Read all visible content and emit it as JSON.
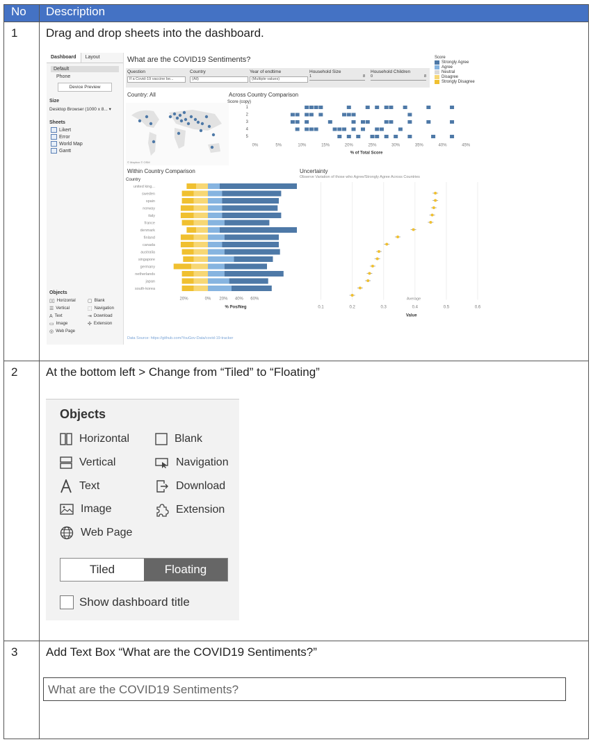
{
  "table": {
    "headers": {
      "no": "No",
      "description": "Description"
    },
    "rows": [
      {
        "no": "1",
        "text": "Drag and drop sheets into the dashboard."
      },
      {
        "no": "2",
        "text": "At the bottom left > Change from “Tiled” to “Floating”"
      },
      {
        "no": "3",
        "text": "Add Text Box “What are the COVID19 Sentiments?”"
      }
    ]
  },
  "dashboard": {
    "tabs": [
      "Dashboard",
      "Layout"
    ],
    "device_items": [
      "Default",
      "Phone"
    ],
    "device_preview_button": "Device Preview",
    "size_heading": "Size",
    "size_value": "Desktop Browser (1000 x 8... ▾",
    "sheets_heading": "Sheets",
    "sheets": [
      "Likert",
      "Error",
      "World Map",
      "Gantt"
    ],
    "objects_heading": "Objects",
    "objects_small": [
      "Horizontal",
      "Blank",
      "Vertical",
      "Navigation",
      "Text",
      "Download",
      "Image",
      "Extension",
      "Web Page"
    ],
    "title": "What are the COVID19 Sentiments?",
    "filters": {
      "question_label": "Question",
      "question_value": "If a Covid-19 vaccine be...",
      "country_label": "Country",
      "country_value": "(All)",
      "year_label": "Year of endtime",
      "year_value": "(Multiple values)",
      "household_size_label": "Household Size",
      "household_size_min": "1",
      "household_size_max": "8",
      "household_children_label": "Household Children",
      "household_children_min": "0",
      "household_children_max": "8"
    },
    "legend": {
      "title": "Score",
      "items": [
        {
          "label": "Strongly Agree",
          "color": "#4e79a7"
        },
        {
          "label": "Agree",
          "color": "#86b4e0"
        },
        {
          "label": "Neutral",
          "color": "#d9d9d9"
        },
        {
          "label": "Disagree",
          "color": "#f7d774"
        },
        {
          "label": "Strongly Disagree",
          "color": "#f0c030"
        }
      ]
    },
    "map_title": "Country: All",
    "map_credit": "© Mapbox © OSM",
    "across_title": "Across Country Comparison",
    "within_title": "Within Country Comparison",
    "uncertainty_title": "Uncertainty",
    "uncertainty_subtitle": "Observe Variation of those who Agree/Strongly Agree Across Countries",
    "data_source": "Data Source: https://github.com/YouGov-Data/covid-19-tracker"
  },
  "chart_data": [
    {
      "type": "scatter",
      "title": "Across Country Comparison",
      "ylabel": "Score (copy)",
      "xlabel": "% of Total Score",
      "categories": [
        "1",
        "2",
        "3",
        "4",
        "5"
      ],
      "x_ticks": [
        "0%",
        "5%",
        "10%",
        "15%",
        "20%",
        "25%",
        "30%",
        "35%",
        "40%",
        "45%"
      ],
      "series": [
        {
          "values": [
            [
              11,
              1
            ],
            [
              12,
              1
            ],
            [
              13,
              1
            ],
            [
              14,
              1
            ],
            [
              20,
              1
            ],
            [
              24,
              1
            ],
            [
              26,
              1
            ],
            [
              28,
              1
            ],
            [
              29,
              1
            ],
            [
              32,
              1
            ],
            [
              37,
              1
            ],
            [
              42,
              1
            ],
            [
              8,
              2
            ],
            [
              9,
              2
            ],
            [
              11,
              2
            ],
            [
              12,
              2
            ],
            [
              14,
              2
            ],
            [
              19,
              2
            ],
            [
              20,
              2
            ],
            [
              21,
              2
            ],
            [
              33,
              2
            ],
            [
              8,
              3
            ],
            [
              9,
              3
            ],
            [
              11,
              3
            ],
            [
              16,
              3
            ],
            [
              21,
              3
            ],
            [
              23,
              3
            ],
            [
              24,
              3
            ],
            [
              28,
              3
            ],
            [
              29,
              3
            ],
            [
              33,
              3
            ],
            [
              37,
              3
            ],
            [
              42,
              3
            ],
            [
              9,
              4
            ],
            [
              11,
              4
            ],
            [
              12,
              4
            ],
            [
              13,
              4
            ],
            [
              17,
              4
            ],
            [
              18,
              4
            ],
            [
              19,
              4
            ],
            [
              21,
              4
            ],
            [
              23,
              4
            ],
            [
              26,
              4
            ],
            [
              27,
              4
            ],
            [
              31,
              4
            ],
            [
              18,
              5
            ],
            [
              20,
              5
            ],
            [
              22,
              5
            ],
            [
              25,
              5
            ],
            [
              26,
              5
            ],
            [
              28,
              5
            ],
            [
              30,
              5
            ],
            [
              33,
              5
            ],
            [
              38,
              5
            ],
            [
              42,
              5
            ]
          ]
        }
      ]
    },
    {
      "type": "bar",
      "title": "Within Country Comparison",
      "xlabel": "% Pos/Neg",
      "ylabel": "Country",
      "categories": [
        "united king...",
        "sweden",
        "spain",
        "norway",
        "italy",
        "france",
        "denmark",
        "finland",
        "canada",
        "australia",
        "singapore",
        "germany",
        "netherlands",
        "japan",
        "south-korea"
      ],
      "x_ticks": [
        "20%",
        "0%",
        "20%",
        "40%",
        "60%"
      ],
      "series": [
        {
          "name": "Strongly Disagree",
          "values": [
            -8,
            -10,
            -10,
            -11,
            -11,
            -10,
            -8,
            -11,
            -11,
            -10,
            -9,
            -15,
            -10,
            -10,
            -10
          ]
        },
        {
          "name": "Disagree",
          "values": [
            -10,
            -12,
            -12,
            -12,
            -12,
            -12,
            -10,
            -12,
            -12,
            -12,
            -12,
            -14,
            -12,
            -12,
            -12
          ]
        },
        {
          "name": "Agree",
          "values": [
            10,
            12,
            12,
            12,
            12,
            14,
            10,
            14,
            12,
            14,
            22,
            14,
            14,
            18,
            20
          ]
        },
        {
          "name": "Strongly Agree",
          "values": [
            78,
            50,
            48,
            47,
            50,
            38,
            76,
            46,
            48,
            47,
            33,
            36,
            50,
            33,
            34
          ]
        }
      ]
    },
    {
      "type": "scatter",
      "title": "Uncertainty",
      "xlabel": "Value",
      "x_ticks": [
        "0.1",
        "0.2",
        "0.3",
        "0.4",
        "0.5",
        "0.6"
      ],
      "annotation": "Average",
      "series": [
        {
          "values": [
            [
              0.465,
              1
            ],
            [
              0.465,
              2
            ],
            [
              0.46,
              3
            ],
            [
              0.455,
              4
            ],
            [
              0.45,
              5
            ],
            [
              0.395,
              6
            ],
            [
              0.345,
              7
            ],
            [
              0.31,
              8
            ],
            [
              0.285,
              9
            ],
            [
              0.28,
              10
            ],
            [
              0.265,
              11
            ],
            [
              0.255,
              12
            ],
            [
              0.25,
              13
            ],
            [
              0.225,
              14
            ],
            [
              0.2,
              15
            ]
          ]
        }
      ]
    }
  ],
  "objects_panel": {
    "title": "Objects",
    "items": [
      "Horizontal",
      "Blank",
      "Vertical",
      "Navigation",
      "Text",
      "Download",
      "Image",
      "Extension",
      "Web Page"
    ],
    "toggle_tiled": "Tiled",
    "toggle_floating": "Floating",
    "show_title_label": "Show dashboard title"
  },
  "textbox": {
    "value": "What are the COVID19 Sentiments?"
  }
}
